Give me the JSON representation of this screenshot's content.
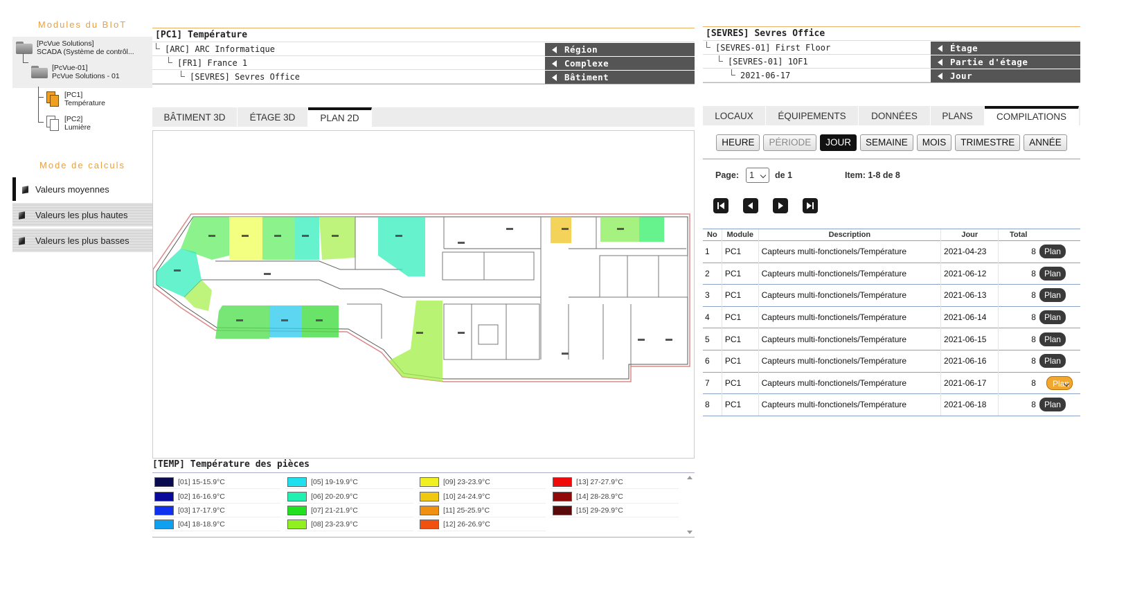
{
  "sidebar": {
    "modules_title": "Modules du BIoT",
    "tree": [
      {
        "line1": "[PcVue Solutions]",
        "line2": "SCADA (Système de contrôl..."
      },
      {
        "line1": "[PcVue-01]",
        "line2": "PcVue Solutions - 01"
      },
      {
        "line1": "[PC1]",
        "line2": "Température"
      },
      {
        "line1": "[PC2]",
        "line2": "Lumière"
      }
    ],
    "calc_title": "Mode de calculs",
    "calc_modes": [
      "Valeurs moyennes",
      "Valeurs les plus hautes",
      "Valeurs les plus basses"
    ]
  },
  "left_header": {
    "title": "[PC1] Température",
    "rows": [
      {
        "text": "[ARC] ARC Informatique",
        "tag": "Région"
      },
      {
        "text": "[FR1] France 1",
        "tag": "Complexe"
      },
      {
        "text": "[SEVRES] Sevres Office",
        "tag": "Bâtiment"
      }
    ]
  },
  "right_header": {
    "title": "[SEVRES] Sevres Office",
    "rows": [
      {
        "text": "[SEVRES-01] First Floor",
        "tag": "Étage"
      },
      {
        "text": "[SEVRES-01] 1OF1",
        "tag": "Partie d'étage"
      },
      {
        "text": "2021-06-17",
        "tag": "Jour"
      }
    ]
  },
  "view_tabs": [
    "BÂTIMENT 3D",
    "ÉTAGE 3D",
    "PLAN 2D"
  ],
  "data_tabs": [
    "LOCAUX",
    "ÉQUIPEMENTS",
    "DONNÉES",
    "PLANS",
    "COMPILATIONS"
  ],
  "legend": {
    "title": "[TEMP] Température des pièces",
    "items": [
      {
        "label": "[01] 15-15.9°C",
        "color": "#0a0a50"
      },
      {
        "label": "[02] 16-16.9°C",
        "color": "#0a0a9a"
      },
      {
        "label": "[03] 17-17.9°C",
        "color": "#1030f0"
      },
      {
        "label": "[04] 18-18.9°C",
        "color": "#10a0f0"
      },
      {
        "label": "[05] 19-19.9°C",
        "color": "#20e0f0"
      },
      {
        "label": "[06] 20-20.9°C",
        "color": "#20f0b0"
      },
      {
        "label": "[07] 21-21.9°C",
        "color": "#20e020"
      },
      {
        "label": "[08] 23-23.9°C",
        "color": "#90f020"
      },
      {
        "label": "[09] 23-23.9°C",
        "color": "#f0f020"
      },
      {
        "label": "[10] 24-24.9°C",
        "color": "#f0c810"
      },
      {
        "label": "[11] 25-25.9°C",
        "color": "#f09010"
      },
      {
        "label": "[12] 26-26.9°C",
        "color": "#f05010"
      },
      {
        "label": "[13] 27-27.9°C",
        "color": "#f00a0a"
      },
      {
        "label": "[14] 28-28.9°C",
        "color": "#900a0a"
      },
      {
        "label": "[15] 29-29.9°C",
        "color": "#5a0a0a"
      }
    ]
  },
  "periods": {
    "buttons": [
      "HEURE",
      "PÉRIODE",
      "JOUR",
      "SEMAINE",
      "MOIS",
      "TRIMESTRE",
      "ANNÉE"
    ],
    "active": "JOUR",
    "disabled": "PÉRIODE"
  },
  "pager": {
    "page_label": "Page:",
    "page_value": "1",
    "of_label": "de 1",
    "items_label": "Item: 1-8 de 8"
  },
  "table": {
    "headers": [
      "No",
      "Module",
      "Description",
      "Jour",
      "Total"
    ],
    "selected_no": "7",
    "rows": [
      {
        "no": "1",
        "module": "PC1",
        "desc": "Capteurs multi-fonctionels/Température",
        "jour": "2021-04-23",
        "total": "8",
        "btn": "Plan"
      },
      {
        "no": "2",
        "module": "PC1",
        "desc": "Capteurs multi-fonctionels/Température",
        "jour": "2021-06-12",
        "total": "8",
        "btn": "Plan"
      },
      {
        "no": "3",
        "module": "PC1",
        "desc": "Capteurs multi-fonctionels/Température",
        "jour": "2021-06-13",
        "total": "8",
        "btn": "Plan"
      },
      {
        "no": "4",
        "module": "PC1",
        "desc": "Capteurs multi-fonctionels/Température",
        "jour": "2021-06-14",
        "total": "8",
        "btn": "Plan"
      },
      {
        "no": "5",
        "module": "PC1",
        "desc": "Capteurs multi-fonctionels/Température",
        "jour": "2021-06-15",
        "total": "8",
        "btn": "Plan"
      },
      {
        "no": "6",
        "module": "PC1",
        "desc": "Capteurs multi-fonctionels/Température",
        "jour": "2021-06-16",
        "total": "8",
        "btn": "Plan"
      },
      {
        "no": "7",
        "module": "PC1",
        "desc": "Capteurs multi-fonctionels/Température",
        "jour": "2021-06-17",
        "total": "8",
        "btn": "Plan"
      },
      {
        "no": "8",
        "module": "PC1",
        "desc": "Capteurs multi-fonctionels/Température",
        "jour": "2021-06-18",
        "total": "8",
        "btn": "Plan"
      }
    ]
  }
}
